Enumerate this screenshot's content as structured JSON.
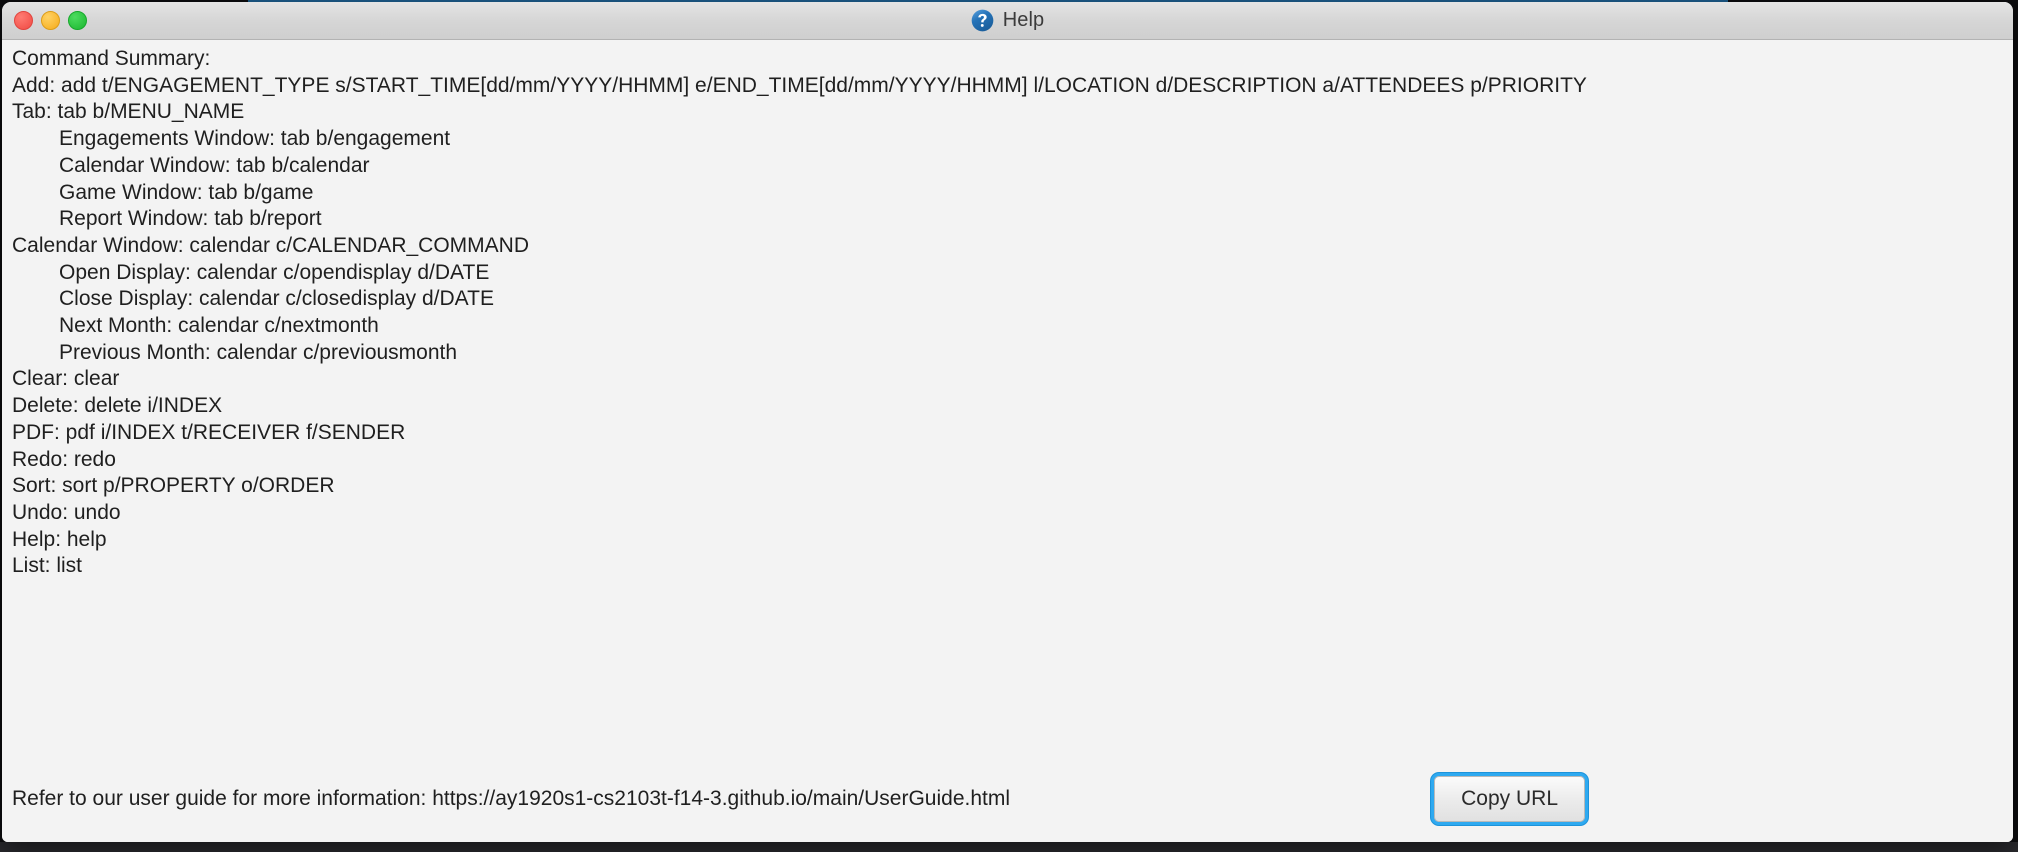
{
  "window": {
    "title": "Help",
    "icon": "help-question-icon",
    "traffic_lights": [
      {
        "name": "close",
        "color": "#ff5f57"
      },
      {
        "name": "minimize",
        "color": "#febc2e"
      },
      {
        "name": "maximize",
        "color": "#28c840"
      }
    ]
  },
  "background_window": {
    "title_fragment": "",
    "accent_color": "#1f5c8b"
  },
  "help": {
    "heading": "Command Summary:",
    "lines": [
      {
        "text": "Command Summary:",
        "indent": false
      },
      {
        "text": "Add: add t/ENGAGEMENT_TYPE s/START_TIME[dd/mm/YYYY/HHMM] e/END_TIME[dd/mm/YYYY/HHMM] l/LOCATION d/DESCRIPTION a/ATTENDEES p/PRIORITY",
        "indent": false
      },
      {
        "text": "Tab: tab b/MENU_NAME",
        "indent": false
      },
      {
        "text": "Engagements Window: tab b/engagement",
        "indent": true
      },
      {
        "text": "Calendar Window: tab b/calendar",
        "indent": true
      },
      {
        "text": "Game Window: tab b/game",
        "indent": true
      },
      {
        "text": "Report Window: tab b/report",
        "indent": true
      },
      {
        "text": "Calendar Window: calendar c/CALENDAR_COMMAND",
        "indent": false
      },
      {
        "text": "Open Display: calendar c/opendisplay d/DATE",
        "indent": true
      },
      {
        "text": "Close Display: calendar c/closedisplay d/DATE",
        "indent": true
      },
      {
        "text": "Next Month: calendar c/nextmonth",
        "indent": true
      },
      {
        "text": "Previous Month: calendar c/previousmonth",
        "indent": true
      },
      {
        "text": "Clear: clear",
        "indent": false
      },
      {
        "text": "Delete: delete i/INDEX",
        "indent": false
      },
      {
        "text": "PDF: pdf i/INDEX t/RECEIVER f/SENDER",
        "indent": false
      },
      {
        "text": "Redo: redo",
        "indent": false
      },
      {
        "text": "Sort: sort p/PROPERTY o/ORDER",
        "indent": false
      },
      {
        "text": "Undo: undo",
        "indent": false
      },
      {
        "text": "Help: help",
        "indent": false
      },
      {
        "text": "List: list",
        "indent": false
      }
    ]
  },
  "footer": {
    "guide_text": "Refer to our user guide for more information: https://ay1920s1-cs2103t-f14-3.github.io/main/UserGuide.html",
    "copy_button_label": "Copy URL",
    "focus_ring_color": "#2ea9f0"
  }
}
